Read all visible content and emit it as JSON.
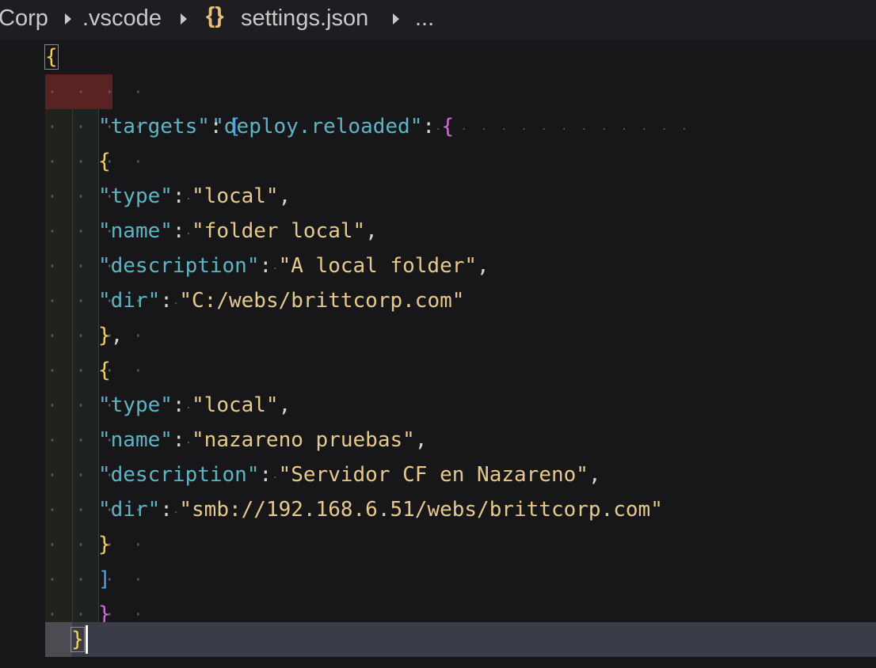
{
  "breadcrumb": {
    "items": [
      "Corp",
      ".vscode",
      "settings.json",
      "..."
    ],
    "file_icon": "{}"
  },
  "colors": {
    "background": "#17171a",
    "key": "#5fb4c4",
    "string": "#e6c98e",
    "brace_outer": "#f2d15c",
    "brace_inner": "#d16ed6",
    "bracket": "#4fa3e8",
    "error_highlight": "#5a2223",
    "current_line": "#3a3d47"
  },
  "code": {
    "l1": "{",
    "l2_key": "\"deploy.reloaded\"",
    "l2_colon": ":",
    "l2_brace": "{",
    "l3_key": "\"targets\"",
    "l3_colon": ":",
    "l3_bracket": "[",
    "l4": "{",
    "l5_key": "\"type\"",
    "l5_colon": ":",
    "l5_val": "\"local\"",
    "l5_comma": ",",
    "l6_key": "\"name\"",
    "l6_colon": ":",
    "l6_val": "\"folder local\"",
    "l6_comma": ",",
    "l7_key": "\"description\"",
    "l7_colon": ":",
    "l7_val": "\"A local folder\"",
    "l7_comma": ",",
    "l8_key": "\"dir\"",
    "l8_colon": ":",
    "l8_val": "\"C:/webs/brittcorp.com\"",
    "l9": "}",
    "l9_comma": ",",
    "l10": "{",
    "l11_key": "\"type\"",
    "l11_colon": ":",
    "l11_val": "\"local\"",
    "l11_comma": ",",
    "l12_key": "\"name\"",
    "l12_colon": ":",
    "l12_val": "\"nazareno pruebas\"",
    "l12_comma": ",",
    "l13_key": "\"description\"",
    "l13_colon": ":",
    "l13_val": "\"Servidor CF en Nazareno\"",
    "l13_comma": ",",
    "l14_key": "\"dir\"",
    "l14_colon": ":",
    "l14_val": "\"smb://192.168.6.51/webs/brittcorp.com\"",
    "l15": "}",
    "l16": "]",
    "l17": "}",
    "l18": "}"
  }
}
